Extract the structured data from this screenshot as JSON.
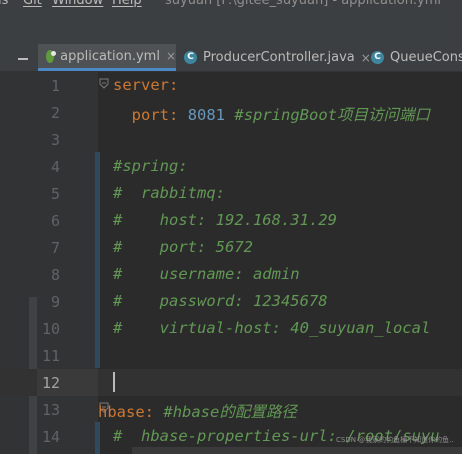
{
  "menubar": {
    "items": [
      "ls",
      "Git",
      "Window",
      "Help"
    ],
    "title": "suyuan [F:\\gitee_suyuan] - application.yml"
  },
  "tabs": [
    {
      "label": "application.yml",
      "icon": "yaml-file-icon",
      "active": true,
      "close": "×"
    },
    {
      "label": "ProducerController.java",
      "icon": "java-class-icon",
      "icon_letter": "C",
      "active": false,
      "close": "×"
    },
    {
      "label": "QueueConsu",
      "icon": "java-class-icon",
      "icon_letter": "C",
      "active": false
    }
  ],
  "editor": {
    "current_line": 12,
    "lines": [
      {
        "n": "1"
      },
      {
        "n": "2"
      },
      {
        "n": "3"
      },
      {
        "n": "4"
      },
      {
        "n": "5"
      },
      {
        "n": "6"
      },
      {
        "n": "7"
      },
      {
        "n": "8"
      },
      {
        "n": "9"
      },
      {
        "n": "10"
      },
      {
        "n": "11"
      },
      {
        "n": "12"
      },
      {
        "n": "13"
      },
      {
        "n": "14"
      }
    ],
    "code": {
      "l1_key": "server",
      "l1_colon": ":",
      "l2_key": "port",
      "l2_colon": ":",
      "l2_value": "8081",
      "l2_comment": "#springBoot项目访问端口",
      "l4": "#spring:",
      "l5": "#  rabbitmq:",
      "l6": "#    host: 192.168.31.29",
      "l7": "#    port: 5672",
      "l8": "#    username: admin",
      "l9": "#    password: 12345678",
      "l10": "#    virtual-host: 40_suyuan_local",
      "l13_key": "hbase",
      "l13_colon": ":",
      "l13_comment": "#hbase的配置路径",
      "l14": "#  hbase-properties-url: /root/suyu"
    }
  },
  "watermark": "CSDN @我家的钓鱼桶不知道你的鱼..",
  "colors": {
    "key": "#cc7832",
    "number": "#6897bb",
    "comment": "#629755",
    "background": "#2b2b2b",
    "gutter": "#313335",
    "active_tab_underline": "#4a88c7"
  }
}
